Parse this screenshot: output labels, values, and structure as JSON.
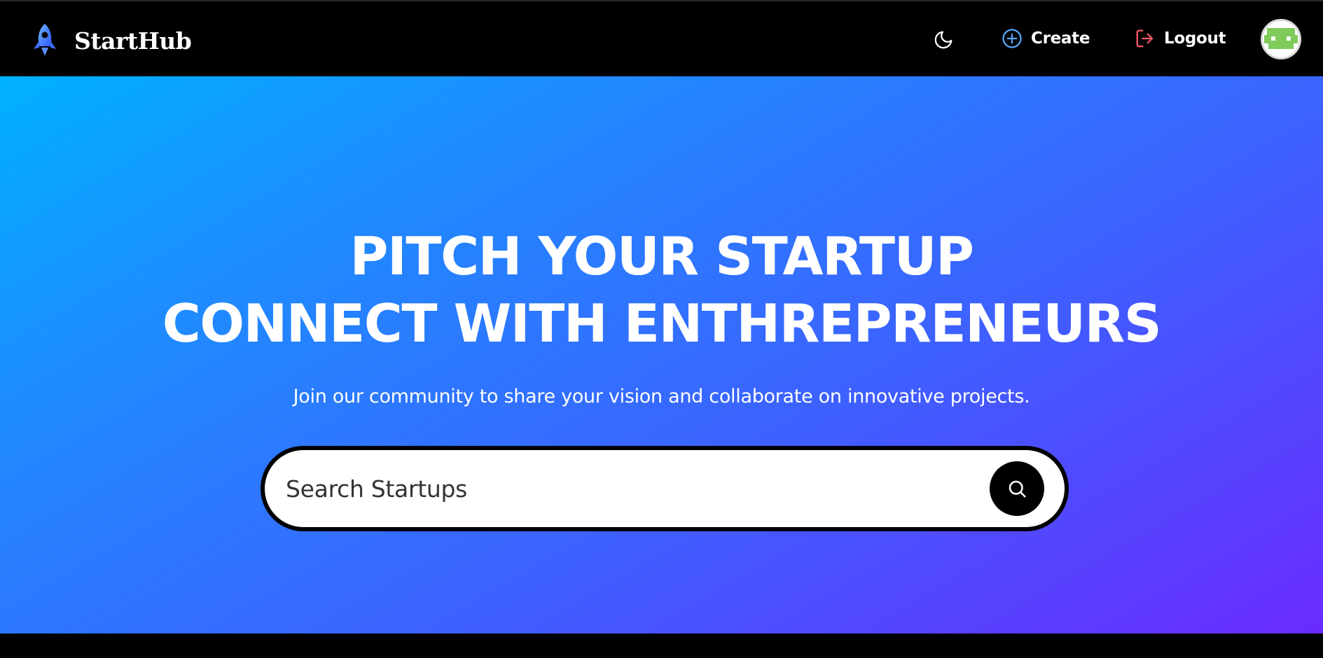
{
  "app": {
    "name": "StartHub"
  },
  "nav": {
    "theme_icon": "moon-icon",
    "create": {
      "label": "Create",
      "icon": "plus-circle-icon",
      "icon_color": "#5aa7ff"
    },
    "logout": {
      "label": "Logout",
      "icon": "logout-icon",
      "icon_color": "#ff5a6a"
    },
    "avatar_icon": "user-avatar"
  },
  "hero": {
    "headline_line1": "PITCH YOUR STARTUP",
    "headline_line2": "CONNECT WITH ENTHREPRENEURS",
    "subtitle": "Join our community to share your vision and collaborate on innovative projects.",
    "gradient": [
      "#00b1ff",
      "#1e8cff",
      "#3c62ff",
      "#6a2bff"
    ]
  },
  "search": {
    "placeholder": "Search Startups",
    "value": "",
    "button_icon": "search-icon"
  },
  "colors": {
    "nav_bg": "#000000",
    "brand_rocket": "#3f6bff",
    "avatar_green": "#7ecb5b"
  }
}
